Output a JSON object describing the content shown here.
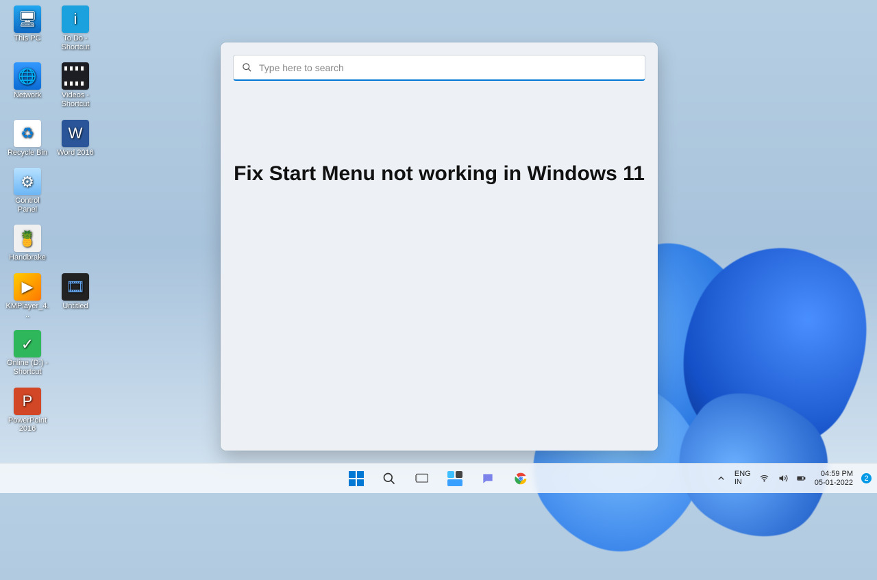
{
  "desktop": {
    "icons": [
      {
        "label": "This PC",
        "glyph": "🖥",
        "cls": "g-pc"
      },
      {
        "label": "To Do - Shortcut",
        "glyph": "i",
        "cls": "g-todo"
      },
      {
        "label": "Network",
        "glyph": "🌐",
        "cls": "g-net"
      },
      {
        "label": "Videos - Shortcut",
        "glyph": "",
        "cls": "g-vid"
      },
      {
        "label": "Recycle Bin",
        "glyph": "♻",
        "cls": "g-bin"
      },
      {
        "label": "Word 2016",
        "glyph": "W",
        "cls": "g-word"
      },
      {
        "label": "Control Panel",
        "glyph": "⚙",
        "cls": "g-cp"
      },
      {
        "label": "",
        "glyph": "",
        "cls": "",
        "empty": true
      },
      {
        "label": "Handbrake",
        "glyph": "🍍",
        "cls": "g-hb"
      },
      {
        "label": "",
        "glyph": "",
        "cls": "",
        "empty": true
      },
      {
        "label": "KMPlayer_4...",
        "glyph": "▶",
        "cls": "g-km"
      },
      {
        "label": "Untitled",
        "glyph": "🎞",
        "cls": "g-unt"
      },
      {
        "label": "Online (D:) - Shortcut",
        "glyph": "✓",
        "cls": "g-online"
      },
      {
        "label": "",
        "glyph": "",
        "cls": "",
        "empty": true
      },
      {
        "label": "PowerPoint 2016",
        "glyph": "P",
        "cls": "g-ppt"
      }
    ]
  },
  "start": {
    "search_placeholder": "Type here to search",
    "caption": "Fix Start Menu not working in Windows 11"
  },
  "taskbar": {
    "items": [
      "start",
      "search",
      "taskview",
      "widgets",
      "chat",
      "chrome"
    ]
  },
  "tray": {
    "lang_top": "ENG",
    "lang_bot": "IN",
    "time": "04:59 PM",
    "date": "05-01-2022",
    "notification_count": "2"
  }
}
